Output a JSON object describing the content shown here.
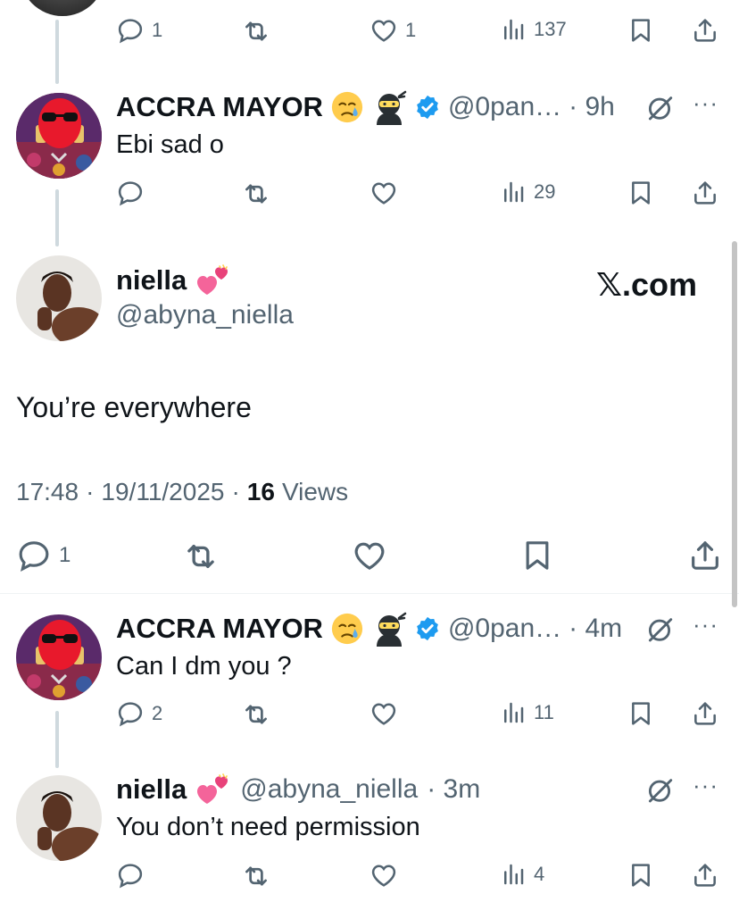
{
  "top_tweet": {
    "reply_count": "1",
    "like_count": "1",
    "view_count": "137"
  },
  "reply1": {
    "name": "ACCRA MAYOR",
    "handle": "@0pan…",
    "time": "· 9h",
    "text": "Ebi sad o",
    "view_count": "29"
  },
  "main_tweet": {
    "name": "niella",
    "handle": "@abyna_niella",
    "watermark": "𝕏.com",
    "text": "You’re everywhere",
    "time": "17:48",
    "date": "19/11/2025",
    "sep1": "·",
    "sep2": "·",
    "views_number": "16",
    "views_label": "Views",
    "reply_count": "1"
  },
  "reply2": {
    "name": "ACCRA MAYOR",
    "handle": "@0pan…",
    "time": "· 4m",
    "text": "Can I dm you ?",
    "reply_count": "2",
    "view_count": "11"
  },
  "reply3": {
    "name": "niella",
    "handle": "@abyna_niella",
    "time": "· 3m",
    "text": "You don’t need permission",
    "view_count": "4"
  },
  "colors": {
    "text_primary": "#0f1419",
    "text_secondary": "#536471",
    "verified_blue": "#1d9bf0",
    "thread_line": "#cfd9de"
  }
}
